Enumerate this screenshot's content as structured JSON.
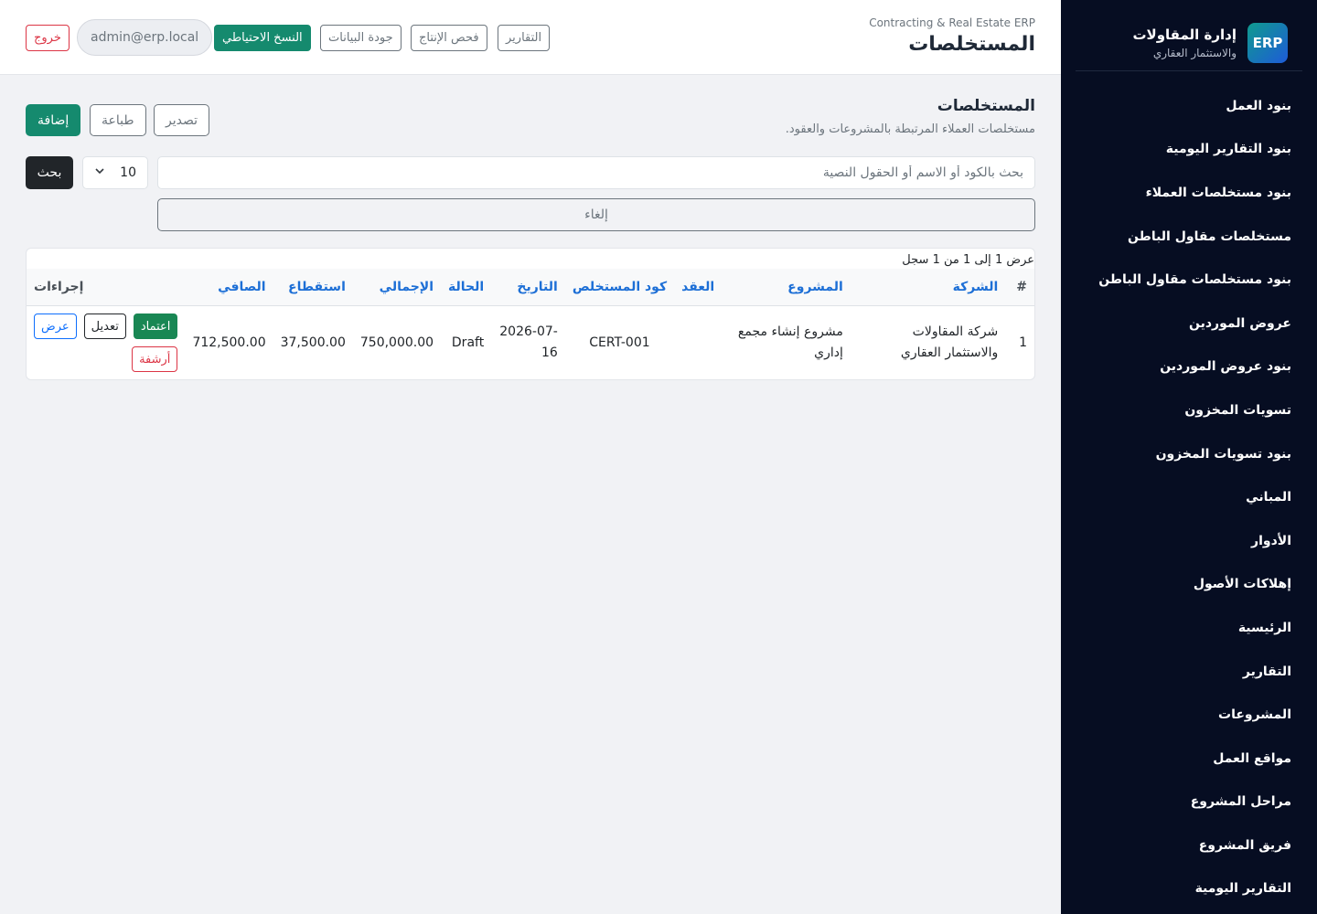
{
  "brand": {
    "logo": "ERP",
    "title": "إدارة المقاولات",
    "subtitle": "والاستثمار العقاري"
  },
  "sidebar": {
    "items": [
      {
        "label": "بنود العمل"
      },
      {
        "label": "بنود التقارير اليومية"
      },
      {
        "label": "بنود مستخلصات العملاء"
      },
      {
        "label": "مستخلصات مقاول الباطن"
      },
      {
        "label": "بنود مستخلصات مقاول الباطن"
      },
      {
        "label": "عروض الموردين"
      },
      {
        "label": "بنود عروض الموردين"
      },
      {
        "label": "تسويات المخزون"
      },
      {
        "label": "بنود تسويات المخزون"
      },
      {
        "label": "المباني"
      },
      {
        "label": "الأدوار"
      },
      {
        "label": "إهلاكات الأصول"
      },
      {
        "label": "الرئيسية"
      },
      {
        "label": "التقارير"
      },
      {
        "label": "المشروعات"
      },
      {
        "label": "مواقع العمل"
      },
      {
        "label": "مراحل المشروع"
      },
      {
        "label": "فريق المشروع"
      },
      {
        "label": "التقارير اليومية"
      }
    ]
  },
  "topbar": {
    "subtitle": "Contracting & Real Estate ERP",
    "title": "المستخلصات",
    "reports": "التقارير",
    "production_check": "فحص الإنتاج",
    "data_quality": "جودة البيانات",
    "backup": "النسخ الاحتياطي",
    "user": "admin@erp.local",
    "logout": "خروج"
  },
  "page": {
    "title": "المستخلصات",
    "description": "مستخلصات العملاء المرتبطة بالمشروعات والعقود.",
    "export": "تصدير",
    "print": "طباعة",
    "add": "إضافة"
  },
  "search": {
    "placeholder": "بحث بالكود أو الاسم أو الحقول النصية",
    "per_page": "10",
    "button": "بحث",
    "cancel": "إلغاء"
  },
  "table": {
    "info": "عرض 1 إلى 1 من 1 سجل",
    "columns": {
      "hash": "#",
      "company": "الشركة",
      "project": "المشروع",
      "contract": "العقد",
      "code": "كود المستخلص",
      "date": "التاريخ",
      "status": "الحالة",
      "total": "الإجمالي",
      "deduction": "استقطاع",
      "net": "الصافي",
      "actions": "إجراءات"
    },
    "rows": [
      {
        "index": "1",
        "company": "شركة المقاولات والاستثمار العقاري",
        "project": "مشروع إنشاء مجمع إداري",
        "contract": "",
        "code": "CERT-001",
        "date": "2026-07-16",
        "status": "Draft",
        "total": "750,000.00",
        "deduction": "37,500.00",
        "net": "712,500.00",
        "view": "عرض",
        "edit": "تعديل",
        "approve": "اعتماد",
        "archive": "أرشفة"
      }
    ]
  }
}
